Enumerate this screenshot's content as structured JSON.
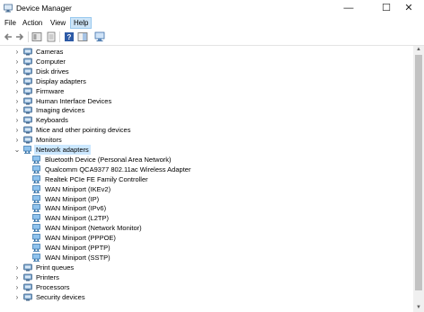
{
  "window": {
    "title": "Device Manager",
    "min": "—",
    "max": "☐",
    "close": "✕"
  },
  "menu": [
    "File",
    "Action",
    "View",
    "Help"
  ],
  "tree": {
    "expander_collapsed": "›",
    "expander_expanded": "⌄",
    "categories_top": [
      {
        "label": "Cameras",
        "icon": "camera-icon"
      },
      {
        "label": "Computer",
        "icon": "computer-icon"
      },
      {
        "label": "Disk drives",
        "icon": "disk-drive-icon"
      },
      {
        "label": "Display adapters",
        "icon": "display-adapter-icon"
      },
      {
        "label": "Firmware",
        "icon": "firmware-icon"
      },
      {
        "label": "Human Interface Devices",
        "icon": "hid-icon"
      },
      {
        "label": "Imaging devices",
        "icon": "imaging-icon"
      },
      {
        "label": "Keyboards",
        "icon": "keyboard-icon"
      },
      {
        "label": "Mice and other pointing devices",
        "icon": "mouse-icon"
      },
      {
        "label": "Monitors",
        "icon": "monitor-icon"
      }
    ],
    "network_label": "Network adapters",
    "network_children": [
      "Bluetooth Device (Personal Area Network)",
      "Qualcomm QCA9377 802.11ac Wireless Adapter",
      "Realtek PCIe FE Family Controller",
      "WAN Miniport (IKEv2)",
      "WAN Miniport (IP)",
      "WAN Miniport (IPv6)",
      "WAN Miniport (L2TP)",
      "WAN Miniport (Network Monitor)",
      "WAN Miniport (PPPOE)",
      "WAN Miniport (PPTP)",
      "WAN Miniport (SSTP)"
    ],
    "categories_bottom": [
      {
        "label": "Print queues",
        "icon": "print-queue-icon"
      },
      {
        "label": "Printers",
        "icon": "printer-icon"
      },
      {
        "label": "Processors",
        "icon": "processor-icon"
      },
      {
        "label": "Security devices",
        "icon": "security-device-icon"
      }
    ]
  },
  "scrollbar": {
    "up": "▲",
    "down": "▼"
  }
}
